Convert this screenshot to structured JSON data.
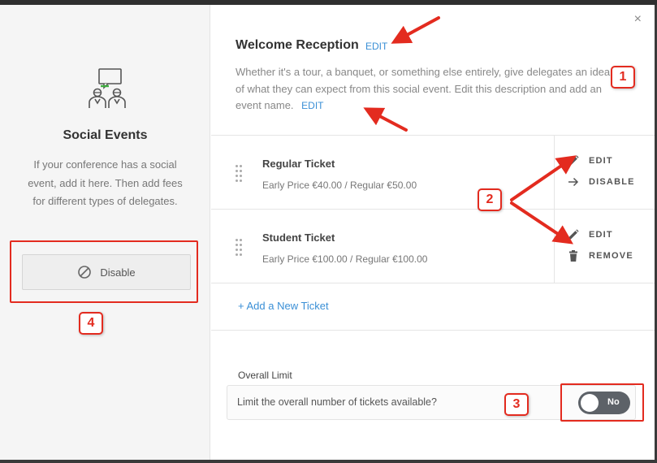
{
  "left_panel": {
    "icon": "social-event-people-icon",
    "title": "Social Events",
    "description": "If your conference has a social event, add it here. Then add fees for different types of delegates.",
    "disable_label": "Disable",
    "disable_icon": "ban-icon"
  },
  "event": {
    "title": "Welcome Reception",
    "title_edit": "EDIT",
    "description": "Whether it's a tour, a banquet, or something else entirely, give delegates an idea of what they can expect from this social event. Edit this description and add an event name.",
    "description_edit": "EDIT"
  },
  "tickets": [
    {
      "name": "Regular Ticket",
      "price": "Early Price €40.00 / Regular €50.00",
      "action1": {
        "icon": "pencil-icon",
        "label": "EDIT"
      },
      "action2": {
        "icon": "arrow-right-icon",
        "label": "DISABLE"
      }
    },
    {
      "name": "Student Ticket",
      "price": "Early Price €100.00 / Regular €100.00",
      "action1": {
        "icon": "pencil-icon",
        "label": "EDIT"
      },
      "action2": {
        "icon": "trash-icon",
        "label": "REMOVE"
      }
    }
  ],
  "add_ticket_label": "+ Add a New Ticket",
  "overall_limit": {
    "label": "Overall Limit",
    "question": "Limit the overall number of tickets available?",
    "toggle_value": "No"
  },
  "close_symbol": "×",
  "annotations": {
    "badges": [
      "1",
      "2",
      "3",
      "4"
    ],
    "color": "#e32b1f"
  },
  "colors": {
    "link": "#3a8fd6",
    "toggle_bg": "#5d6268",
    "left_bg": "#f5f5f5"
  }
}
